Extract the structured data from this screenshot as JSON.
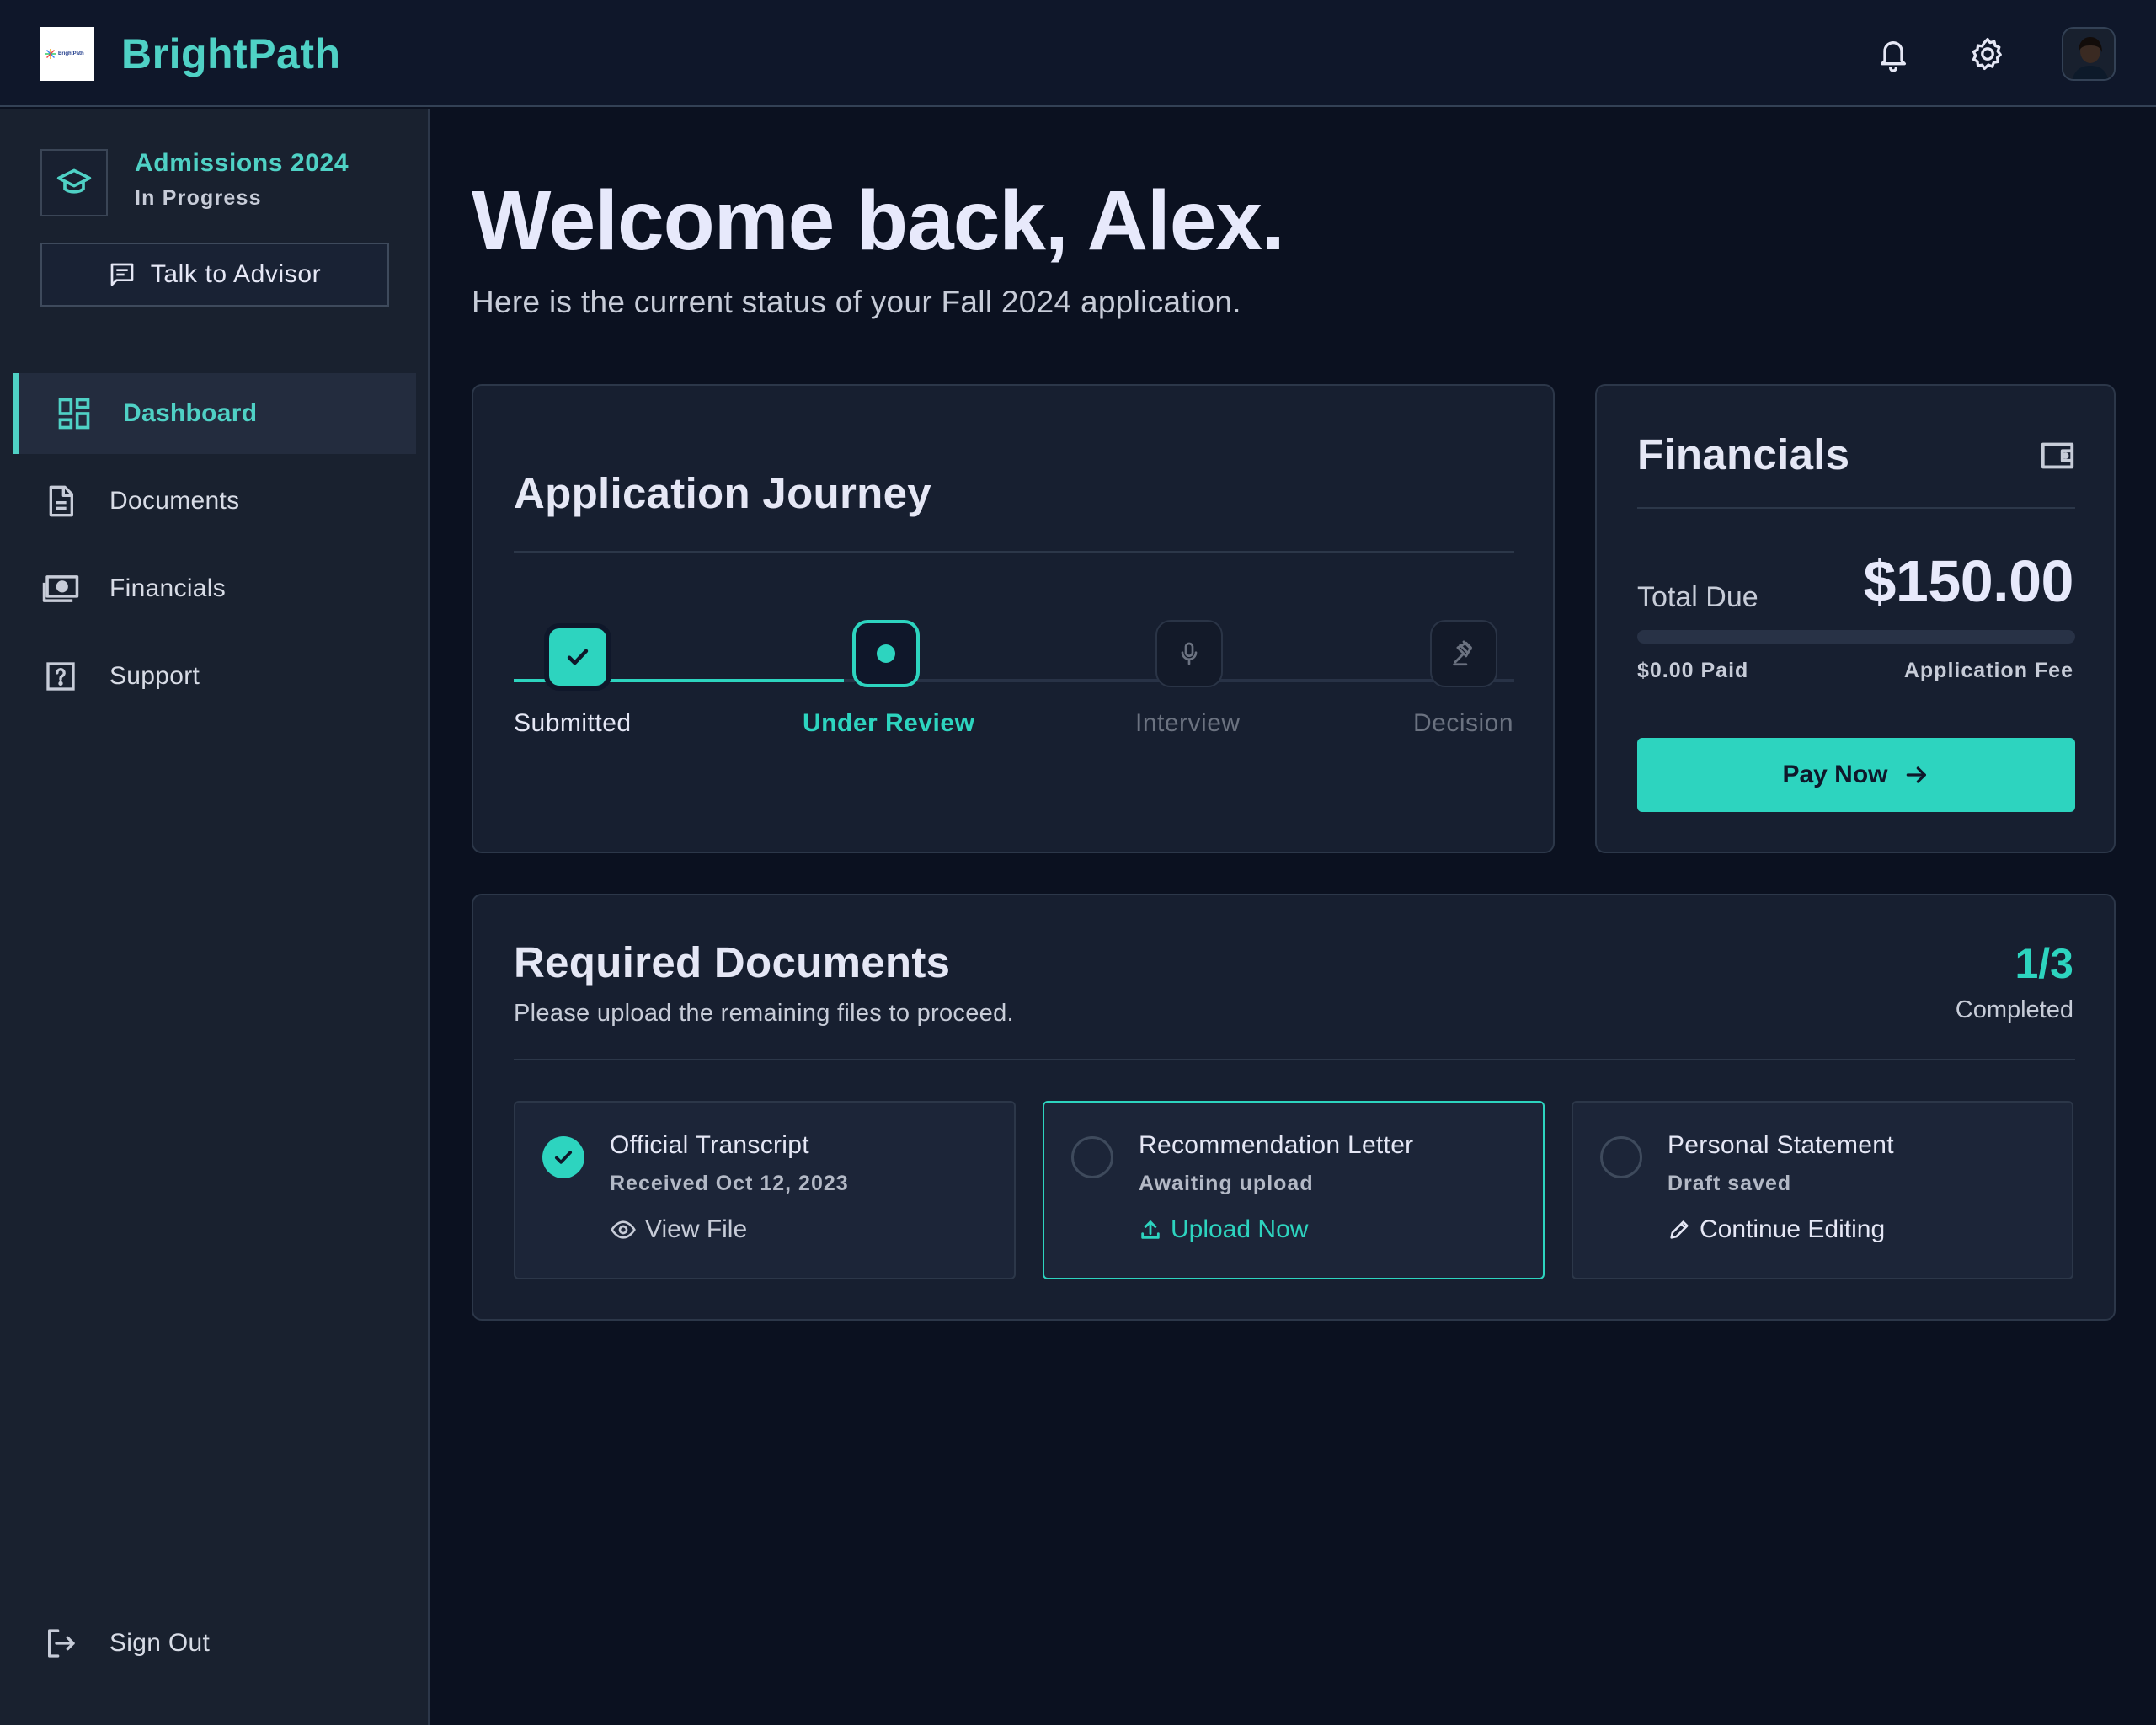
{
  "header": {
    "brand": "BrightPath",
    "logo_text": "BrightPath",
    "icons": [
      "bell-icon",
      "gear-icon"
    ],
    "accent_color": "#4fd1c5"
  },
  "sidebar": {
    "admissions_title": "Admissions 2024",
    "admissions_status": "In Progress",
    "advisor_button": "Talk to Advisor",
    "nav": [
      {
        "label": "Dashboard",
        "icon": "dashboard-icon",
        "active": true
      },
      {
        "label": "Documents",
        "icon": "document-icon",
        "active": false
      },
      {
        "label": "Financials",
        "icon": "money-icon",
        "active": false
      },
      {
        "label": "Support",
        "icon": "help-icon",
        "active": false
      }
    ],
    "sign_out": "Sign Out"
  },
  "main": {
    "welcome": "Welcome back, Alex.",
    "subtitle": "Here is the current status of your Fall 2024 application."
  },
  "journey": {
    "title": "Application Journey",
    "steps": [
      {
        "label": "Submitted",
        "state": "complete",
        "icon": "check-icon"
      },
      {
        "label": "Under Review",
        "state": "current",
        "icon": "dot-icon"
      },
      {
        "label": "Interview",
        "state": "pending",
        "icon": "microphone-icon"
      },
      {
        "label": "Decision",
        "state": "pending",
        "icon": "gavel-icon"
      }
    ],
    "progress_fraction": 0.33
  },
  "financials": {
    "title": "Financials",
    "icon": "wallet-icon",
    "total_label": "Total Due",
    "total_amount": "$150.00",
    "paid_label": "$0.00 Paid",
    "fee_label": "Application Fee",
    "paid_fraction": 0,
    "pay_button": "Pay Now"
  },
  "documents": {
    "title": "Required Documents",
    "subtitle": "Please upload the remaining files to proceed.",
    "count": "1/3",
    "count_label": "Completed",
    "items": [
      {
        "title": "Official Transcript",
        "sub": "Received Oct 12, 2023",
        "action": "View File",
        "action_icon": "eye-icon",
        "done": true
      },
      {
        "title": "Recommendation Letter",
        "sub": "Awaiting upload",
        "action": "Upload Now",
        "action_icon": "upload-icon",
        "done": false
      },
      {
        "title": "Personal Statement",
        "sub": "Draft saved",
        "action": "Continue Editing",
        "action_icon": "pencil-icon",
        "done": false
      }
    ]
  }
}
